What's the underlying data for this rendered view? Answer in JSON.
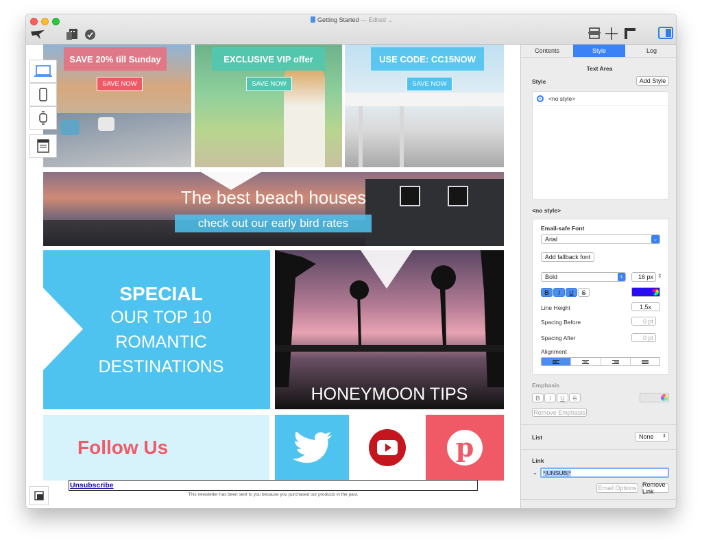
{
  "window": {
    "title": "Getting Started",
    "edited": "— Edited ⌄"
  },
  "colors": {
    "accent": "#3b82f6",
    "sky": "#4fc3ef",
    "coral": "#f05a67",
    "teal": "#50c8b1",
    "pink_banner": "#e8707f"
  },
  "banners": [
    {
      "headline": "SAVE 20% till Sunday",
      "button": "SAVE NOW"
    },
    {
      "headline": "EXCLUSIVE VIP offer",
      "button": "SAVE NOW"
    },
    {
      "headline": "USE CODE: CC15NOW",
      "button": "SAVE NOW"
    }
  ],
  "beach": {
    "title": "The best beach houses",
    "subtitle": "check out our early bird rates"
  },
  "special": {
    "line1": "SPECIAL",
    "line2": "OUR TOP 10",
    "line3": "ROMANTIC",
    "line4": "DESTINATIONS"
  },
  "honeymoon": "HONEYMOON TIPS",
  "follow": "Follow Us",
  "footer": {
    "unsubscribe": "Unsubscribe",
    "note": "This newsletter has been sent to you because you purchased our products in the past."
  },
  "icons": {
    "logo": "bird-icon",
    "layout": "layout-icon",
    "ruler": "ruler-icon",
    "crosshair": "crosshair-icon",
    "sidebar": "sidebar-toggle-icon"
  },
  "sidebar": {
    "tabs": [
      "Contents",
      "Style",
      "Log"
    ],
    "active_tab": "Style",
    "section_title": "Text Area",
    "style_label": "Style",
    "add_style": "Add Style",
    "no_style_item": "<no style>",
    "no_style_heading": "<no style>",
    "email_safe_font": "Email-safe Font",
    "font_value": "Arial",
    "add_fallback": "Add fallback font",
    "weight_value": "Bold",
    "size_value": "16 px",
    "format_b": "B",
    "format_i": "I",
    "format_u": "U",
    "format_s": "S",
    "text_color": "#2a0cf0",
    "line_height_label": "Line Height",
    "line_height_value": "1,5x",
    "spacing_before_label": "Spacing Before",
    "spacing_before_value": "0 pt",
    "spacing_after_label": "Spacing After",
    "spacing_after_value": "0 pt",
    "alignment_label": "Alignment",
    "emphasis_label": "Emphasis",
    "remove_emphasis": "Remove Emphasis",
    "list_label": "List",
    "list_value": "None",
    "link_label": "Link",
    "link_value": "*|UNSUB|*",
    "email_options": "Email Options",
    "remove_link": "Remove Link"
  }
}
